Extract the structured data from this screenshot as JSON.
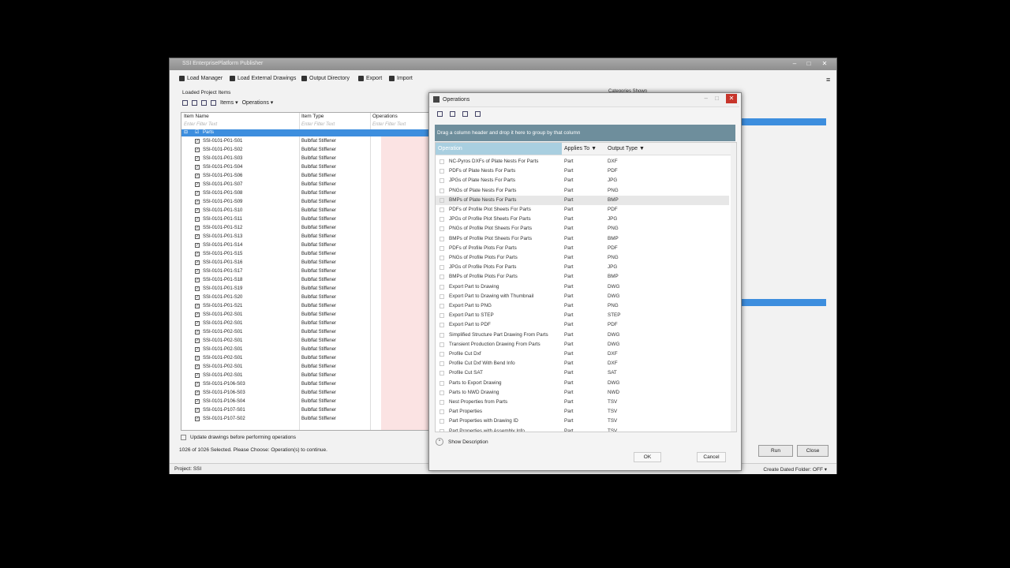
{
  "main_window": {
    "title": "SSI EnterprisePlatform Publisher",
    "toolbar": {
      "load_manager": "Load Manager",
      "load_external": "Load External Drawings",
      "output_directory": "Output Directory",
      "export": "Export",
      "import": "Import"
    },
    "panel_label": "Loaded Project Items",
    "panel_menu": {
      "items": "Items",
      "operations": "Operations"
    },
    "grid": {
      "headers": {
        "item_name": "Item Name",
        "item_type": "Item Type",
        "operations": "Operations"
      },
      "filter_placeholder": "Enter Filter Text",
      "group_label": "Parts",
      "rows": [
        {
          "name": "SSI-0101-P01-S01",
          "type": "Bulbflat Stiffener"
        },
        {
          "name": "SSI-0101-P01-S02",
          "type": "Bulbflat Stiffener"
        },
        {
          "name": "SSI-0101-P01-S03",
          "type": "Bulbflat Stiffener"
        },
        {
          "name": "SSI-0101-P01-S04",
          "type": "Bulbflat Stiffener"
        },
        {
          "name": "SSI-0101-P01-S06",
          "type": "Bulbflat Stiffener"
        },
        {
          "name": "SSI-0101-P01-S07",
          "type": "Bulbflat Stiffener"
        },
        {
          "name": "SSI-0101-P01-S08",
          "type": "Bulbflat Stiffener"
        },
        {
          "name": "SSI-0101-P01-S09",
          "type": "Bulbflat Stiffener"
        },
        {
          "name": "SSI-0101-P01-S10",
          "type": "Bulbflat Stiffener"
        },
        {
          "name": "SSI-0101-P01-S11",
          "type": "Bulbflat Stiffener"
        },
        {
          "name": "SSI-0101-P01-S12",
          "type": "Bulbflat Stiffener"
        },
        {
          "name": "SSI-0101-P01-S13",
          "type": "Bulbflat Stiffener"
        },
        {
          "name": "SSI-0101-P01-S14",
          "type": "Bulbflat Stiffener"
        },
        {
          "name": "SSI-0101-P01-S15",
          "type": "Bulbflat Stiffener"
        },
        {
          "name": "SSI-0101-P01-S16",
          "type": "Bulbflat Stiffener"
        },
        {
          "name": "SSI-0101-P01-S17",
          "type": "Bulbflat Stiffener"
        },
        {
          "name": "SSI-0101-P01-S18",
          "type": "Bulbflat Stiffener"
        },
        {
          "name": "SSI-0101-P01-S19",
          "type": "Bulbflat Stiffener"
        },
        {
          "name": "SSI-0101-P01-S20",
          "type": "Bulbflat Stiffener"
        },
        {
          "name": "SSI-0101-P01-S21",
          "type": "Bulbflat Stiffener"
        },
        {
          "name": "SSI-0101-P02-S01",
          "type": "Bulbflat Stiffener"
        },
        {
          "name": "SSI-0101-P02-S01",
          "type": "Bulbflat Stiffener"
        },
        {
          "name": "SSI-0101-P02-S01",
          "type": "Bulbflat Stiffener"
        },
        {
          "name": "SSI-0101-P02-S01",
          "type": "Bulbflat Stiffener"
        },
        {
          "name": "SSI-0101-P02-S01",
          "type": "Bulbflat Stiffener"
        },
        {
          "name": "SSI-0101-P02-S01",
          "type": "Bulbflat Stiffener"
        },
        {
          "name": "SSI-0101-P02-S01",
          "type": "Bulbflat Stiffener"
        },
        {
          "name": "SSI-0101-P02-S01",
          "type": "Bulbflat Stiffener"
        },
        {
          "name": "SSI-0101-P106-S03",
          "type": "Bulbflat Stiffener"
        },
        {
          "name": "SSI-0101-P106-S03",
          "type": "Bulbflat Stiffener"
        },
        {
          "name": "SSI-0101-P106-S04",
          "type": "Bulbflat Stiffener"
        },
        {
          "name": "SSI-0101-P107-S01",
          "type": "Bulbflat Stiffener"
        },
        {
          "name": "SSI-0101-P107-S02",
          "type": "Bulbflat Stiffener"
        }
      ]
    },
    "update_label": "Update drawings before performing operations",
    "selection_info": "1026 of 1026 Selected. Please Choose: Operation(s) to continue.",
    "categories_label": "Categories Shown",
    "run_label": "Run",
    "close_label": "Close",
    "project_label": "Project:  SSI",
    "dated_folder": "Create Dated Folder:   OFF"
  },
  "dialog": {
    "title": "Operations",
    "group_hint": "Drag a column header and drop it here to group by that column",
    "headers": {
      "operation": "Operation",
      "applies_to": "Applies To",
      "output_type": "Output Type"
    },
    "rows": [
      {
        "op": "NC-Pyros DXFs of Plate Nests For Parts",
        "applies": "Part",
        "type": "DXF"
      },
      {
        "op": "PDFs of Plate Nests For Parts",
        "applies": "Part",
        "type": "PDF"
      },
      {
        "op": "JPGs of Plate Nests For Parts",
        "applies": "Part",
        "type": "JPG"
      },
      {
        "op": "PNGs of Plate Nests For Parts",
        "applies": "Part",
        "type": "PNG"
      },
      {
        "op": "BMPs of Plate Nests For Parts",
        "applies": "Part",
        "type": "BMP"
      },
      {
        "op": "PDFs of Profile Plot Sheets For Parts",
        "applies": "Part",
        "type": "PDF"
      },
      {
        "op": "JPGs of Profile Plot Sheets For Parts",
        "applies": "Part",
        "type": "JPG"
      },
      {
        "op": "PNGs of Profile Plot Sheets For Parts",
        "applies": "Part",
        "type": "PNG"
      },
      {
        "op": "BMPs of Profile Plot Sheets For Parts",
        "applies": "Part",
        "type": "BMP"
      },
      {
        "op": "PDFs of Profile Plots For Parts",
        "applies": "Part",
        "type": "PDF"
      },
      {
        "op": "PNGs of Profile Plots For Parts",
        "applies": "Part",
        "type": "PNG"
      },
      {
        "op": "JPGs of Profile Plots For Parts",
        "applies": "Part",
        "type": "JPG"
      },
      {
        "op": "BMPs of Profile Plots For Parts",
        "applies": "Part",
        "type": "BMP"
      },
      {
        "op": "Export Part to Drawing",
        "applies": "Part",
        "type": "DWG"
      },
      {
        "op": "Export Part to Drawing with Thumbnail",
        "applies": "Part",
        "type": "DWG"
      },
      {
        "op": "Export Part to PNG",
        "applies": "Part",
        "type": "PNG"
      },
      {
        "op": "Export Part to STEP",
        "applies": "Part",
        "type": "STEP"
      },
      {
        "op": "Export Part to PDF",
        "applies": "Part",
        "type": "PDF"
      },
      {
        "op": "Simplified Structure Part Drawing From Parts",
        "applies": "Part",
        "type": "DWG"
      },
      {
        "op": "Transient Production Drawing From Parts",
        "applies": "Part",
        "type": "DWG"
      },
      {
        "op": "Profile Cut Dxf",
        "applies": "Part",
        "type": "DXF"
      },
      {
        "op": "Profile Cut Dxf With Bend Info",
        "applies": "Part",
        "type": "DXF"
      },
      {
        "op": "Profile Cut SAT",
        "applies": "Part",
        "type": "SAT"
      },
      {
        "op": "Parts to Export Drawing",
        "applies": "Part",
        "type": "DWG"
      },
      {
        "op": "Parts to NWD Drawing",
        "applies": "Part",
        "type": "NWD"
      },
      {
        "op": "Nest Properties from Parts",
        "applies": "Part",
        "type": "TSV"
      },
      {
        "op": "Part Properties",
        "applies": "Part",
        "type": "TSV"
      },
      {
        "op": "Part Properties with Drawing ID",
        "applies": "Part",
        "type": "TSV"
      },
      {
        "op": "Part Properties with Assembly Info",
        "applies": "Part",
        "type": "TSV"
      }
    ],
    "show_description": "Show Description",
    "ok_label": "OK",
    "cancel_label": "Cancel"
  }
}
